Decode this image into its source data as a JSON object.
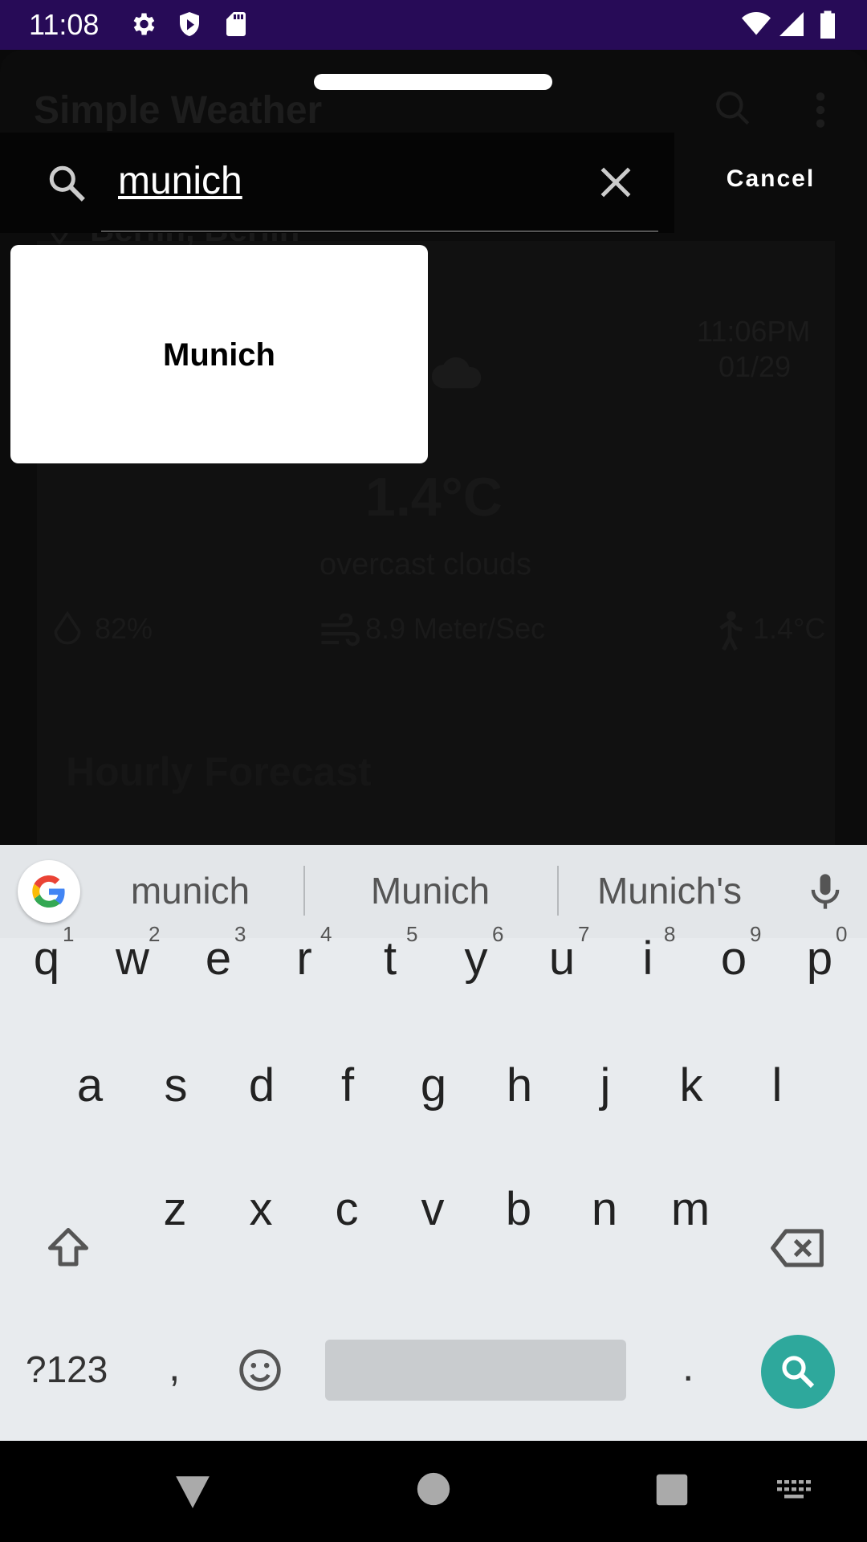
{
  "status_bar": {
    "time": "11:08",
    "icons": [
      "gear-icon",
      "shield-icon",
      "sd-card-icon",
      "wifi-icon",
      "signal-icon",
      "battery-icon"
    ]
  },
  "background_app": {
    "title": "Simple Weather",
    "location": "Berlin, Berlin",
    "time": "11:06PM",
    "date": "01/29",
    "temperature": "1.4°C",
    "condition": "overcast clouds",
    "humidity": "82%",
    "wind": "8.9 Meter/Sec",
    "feels_like": "1.4°C",
    "section_title": "Hourly Forecast"
  },
  "search": {
    "query": "munich",
    "cancel_label": "Cancel"
  },
  "suggestions": [
    {
      "label": "Munich"
    }
  ],
  "keyboard": {
    "word_suggestions": [
      "munich",
      "Munich",
      "Munich's"
    ],
    "row1": [
      {
        "k": "q",
        "n": "1"
      },
      {
        "k": "w",
        "n": "2"
      },
      {
        "k": "e",
        "n": "3"
      },
      {
        "k": "r",
        "n": "4"
      },
      {
        "k": "t",
        "n": "5"
      },
      {
        "k": "y",
        "n": "6"
      },
      {
        "k": "u",
        "n": "7"
      },
      {
        "k": "i",
        "n": "8"
      },
      {
        "k": "o",
        "n": "9"
      },
      {
        "k": "p",
        "n": "0"
      }
    ],
    "row2": [
      "a",
      "s",
      "d",
      "f",
      "g",
      "h",
      "j",
      "k",
      "l"
    ],
    "row3": [
      "z",
      "x",
      "c",
      "v",
      "b",
      "n",
      "m"
    ],
    "symbols_label": "?123",
    "comma": ",",
    "period": "."
  },
  "colors": {
    "status_bar": "#270b57",
    "search_key": "#2ea89c",
    "keyboard_bg": "#e8ebee"
  }
}
